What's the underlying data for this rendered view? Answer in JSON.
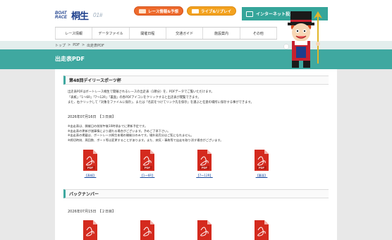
{
  "header": {
    "logo_boat": "BOAT RACE",
    "logo_name": "桐生",
    "logo_num": "01#",
    "btn_race": "レース情報&予想",
    "btn_live": "ライブ&リプレイ",
    "btn_net": "インターネット投票"
  },
  "nav": [
    "レース情報",
    "データファイル",
    "開催日程",
    "交通ガイド",
    "施設案内",
    "その他"
  ],
  "breadcrumb": [
    "トップ",
    ">",
    "PDF",
    ">",
    "出走表PDF"
  ],
  "page_title": "出走表PDF",
  "section1": {
    "title": "第48回デイリースポーツ杯",
    "desc": [
      "出走表PDFはボートレース桐生で開催されるレースの出走表（1節分）を、PDFデータでご覧いただけます。",
      "「表紙」「1～6R」「7～12R」「裏面」の各PDFアイコンをクリックすると出走表が閲覧できます。",
      "また、右クリックして「対象をファイルに保存」、または「名前をつけてリンク先を保存」を選ぶと任意の場所に保存する事ができます。"
    ],
    "date": "2026年07月16日　【３日目】",
    "notes": [
      "※出走表は、開催日の前前午後10時頃までに更新予定です。",
      "※出走表の更新が諸事情により遅れる場合がございます。予めご了承下さい。",
      "※出走表の掲載は、ボートレース桐生本場の開催分のみです。場外発売分はご覧になれません。",
      "※締切時刻、周回数、ボート等は変更することがあります。また、病気・事故等で出走を取り消す場合がございます。"
    ],
    "pdfs": [
      "【表紙】",
      "【1～6R】",
      "【7～12R】",
      "【裏面】"
    ]
  },
  "section2": {
    "title": "バックナンバー",
    "date": "2026年07月15日　【２日目】"
  },
  "colors": {
    "accent": "#3fa8a0",
    "pdf_red": "#d42a1e"
  }
}
